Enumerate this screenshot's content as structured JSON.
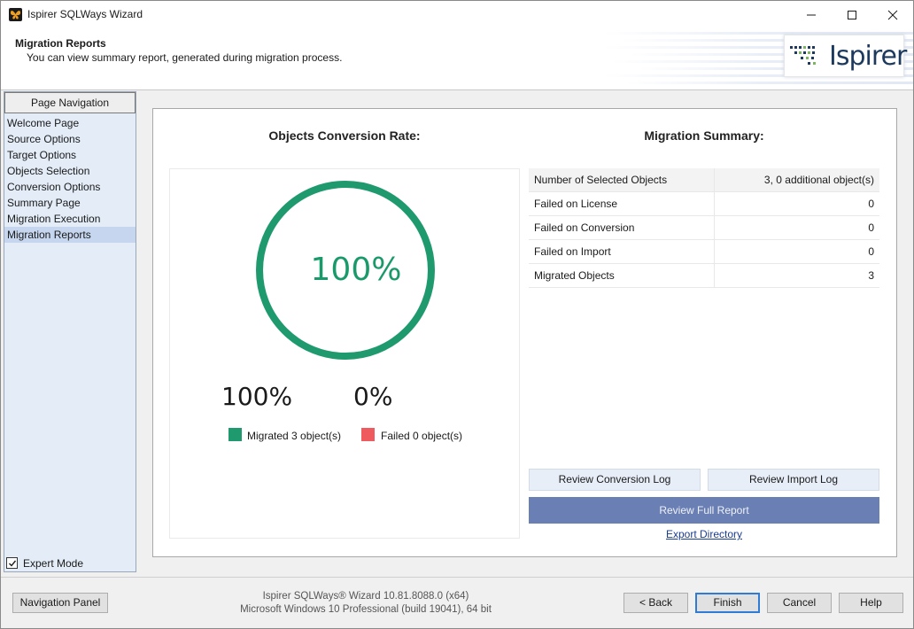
{
  "window": {
    "title": "Ispirer SQLWays Wizard"
  },
  "header": {
    "title": "Migration Reports",
    "subtitle": "You can view summary report, generated during migration process.",
    "logo_text": "Ispirer"
  },
  "nav": {
    "header": "Page Navigation",
    "items": [
      {
        "label": "Welcome Page"
      },
      {
        "label": "Source Options"
      },
      {
        "label": "Target Options"
      },
      {
        "label": "Objects Selection"
      },
      {
        "label": "Conversion Options"
      },
      {
        "label": "Summary Page"
      },
      {
        "label": "Migration Execution"
      },
      {
        "label": "Migration Reports"
      }
    ],
    "active_index": 7,
    "expert_mode_label": "Expert Mode",
    "expert_mode_checked": true
  },
  "conversion": {
    "title": "Objects Conversion Rate:",
    "ring_percent": "100%",
    "ring_fraction": 1.0,
    "migrated_percent": "100%",
    "failed_percent": "0%",
    "legend_migrated": "Migrated 3 object(s)",
    "legend_failed": "Failed 0 object(s)",
    "colors": {
      "migrated": "#1f9a6e",
      "failed": "#ef5a5f"
    }
  },
  "summary": {
    "title": "Migration Summary:",
    "rows": [
      {
        "label": "Number of Selected Objects",
        "value": "3, 0 additional object(s)"
      },
      {
        "label": "Failed on License",
        "value": "0"
      },
      {
        "label": "Failed on Conversion",
        "value": "0"
      },
      {
        "label": "Failed on Import",
        "value": "0"
      },
      {
        "label": "Migrated Objects",
        "value": "3"
      }
    ],
    "review_conversion_log": "Review Conversion Log",
    "review_import_log": "Review Import Log",
    "review_full_report": "Review Full Report",
    "export_directory": "Export Directory"
  },
  "footer": {
    "navigation_panel": "Navigation Panel",
    "version_line1": "Ispirer SQLWays® Wizard 10.81.8088.0 (x64)",
    "version_line2": "Microsoft Windows 10 Professional (build 19041), 64 bit",
    "back": "< Back",
    "finish": "Finish",
    "cancel": "Cancel",
    "help": "Help"
  },
  "icons": {
    "app": "butterfly-icon",
    "minimize": "minimize-icon",
    "maximize": "maximize-icon",
    "close": "close-icon",
    "logo": "ispirer-logo-icon",
    "checkbox": "checkmark-icon"
  },
  "accent_colors": {
    "ring": "#1f9a6e",
    "primary_button": "#6a7fb3",
    "link": "#1a3d8f"
  }
}
